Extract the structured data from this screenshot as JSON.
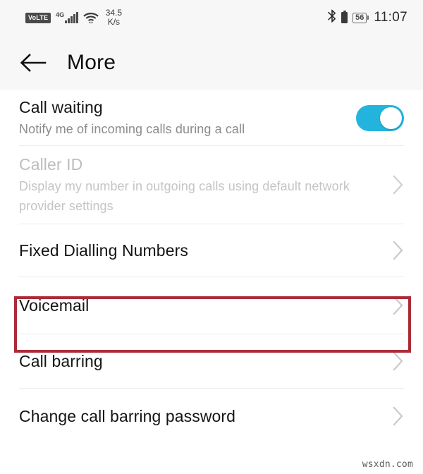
{
  "status_bar": {
    "volte_label": "VoLTE",
    "network_type": "4G",
    "signal_icon": "signal-bars-icon",
    "wifi_icon": "wifi-icon",
    "data_speed_value": "34.5",
    "data_speed_unit": "K/s",
    "bluetooth_icon": "bluetooth-icon",
    "battery_icon": "battery-icon",
    "battery_percent": "56",
    "time": "11:07"
  },
  "app_bar": {
    "back_icon": "back-arrow-icon",
    "title": "More"
  },
  "settings": {
    "rows": [
      {
        "id": "call-waiting",
        "title": "Call waiting",
        "subtitle": "Notify me of incoming calls during a call",
        "control": "toggle",
        "toggle_on": true,
        "disabled": false
      },
      {
        "id": "caller-id",
        "title": "Caller ID",
        "subtitle": "Display my number in outgoing calls using default network provider settings",
        "control": "chevron",
        "disabled": true
      },
      {
        "id": "fixed-dialling-numbers",
        "title": "Fixed Dialling Numbers",
        "subtitle": "",
        "control": "chevron",
        "disabled": false
      },
      {
        "id": "voicemail",
        "title": "Voicemail",
        "subtitle": "",
        "control": "chevron",
        "disabled": false,
        "highlighted": true
      },
      {
        "id": "call-barring",
        "title": "Call barring",
        "subtitle": "",
        "control": "chevron",
        "disabled": false
      },
      {
        "id": "change-call-barring-password",
        "title": "Change call barring password",
        "subtitle": "",
        "control": "chevron",
        "disabled": false
      }
    ]
  },
  "annotation": {
    "highlight_color": "#ab2b37",
    "highlight_target": "voicemail"
  },
  "watermark": {
    "text": "wsxdn.com"
  },
  "colors": {
    "accent_toggle": "#23b4de",
    "status_bar_bg": "#f7f7f7",
    "content_bg": "#ffffff",
    "divider": "#ececec",
    "disabled_text": "#bdbdbd"
  }
}
